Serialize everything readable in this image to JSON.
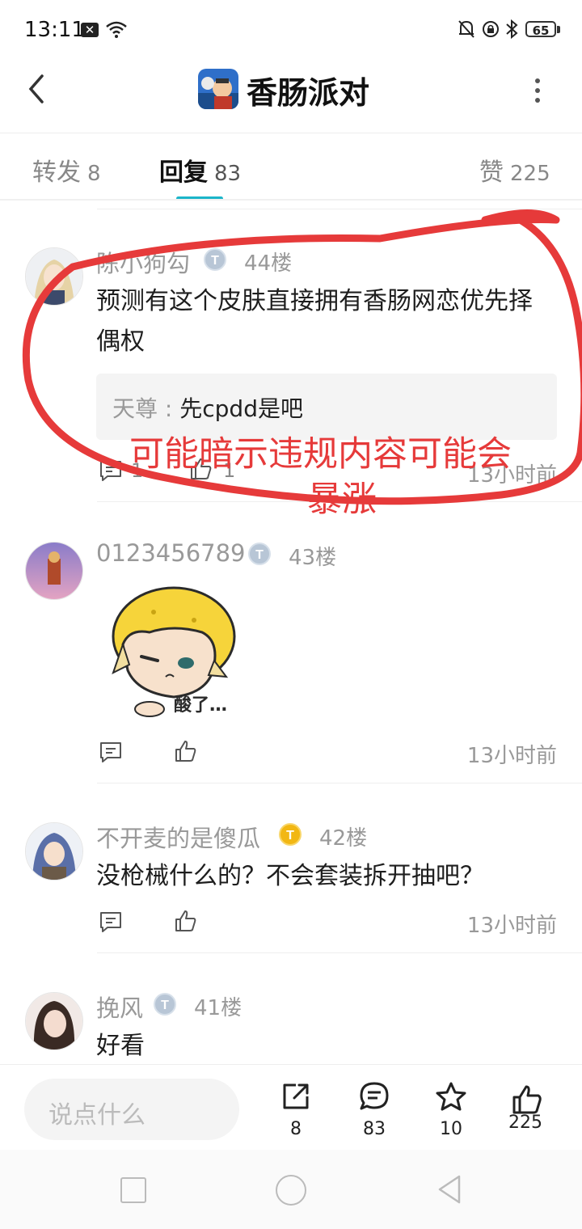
{
  "status_bar": {
    "time": "13:11",
    "battery": "65"
  },
  "header": {
    "title": "香肠派对"
  },
  "tabs": [
    {
      "label": "转发",
      "count": "8"
    },
    {
      "label": "回复",
      "count": "83"
    },
    {
      "label": "赞",
      "count": "225"
    }
  ],
  "comments": [
    {
      "user": "陈小狗勾",
      "floor": "44楼",
      "text_line1": "预测有这个皮肤直接拥有香肠网恋优先择",
      "text_line2": "偶权",
      "reply_author": "天尊",
      "reply_sep": " : ",
      "reply_text": "先cpdd是吧",
      "reply_count": "1",
      "like_count": "1",
      "time": "13小时前"
    },
    {
      "user": "0123456789",
      "floor": "43楼",
      "sticker_text": "酸了…",
      "time": "13小时前"
    },
    {
      "user": "不开麦的是傻瓜",
      "floor": "42楼",
      "text": "没枪械什么的？不会套装拆开抽吧？",
      "time": "13小时前"
    },
    {
      "user": "挽风",
      "floor": "41楼",
      "text": "好看"
    }
  ],
  "annotation": {
    "line1": "可能暗示违规内容可能会",
    "line2": "暴涨",
    "color": "#e63a3a"
  },
  "bottom": {
    "placeholder": "说点什么",
    "share": "8",
    "comment": "83",
    "favorite": "10",
    "like": "225"
  },
  "icons": [
    "back-icon",
    "more-icon",
    "comment-icon",
    "like-icon",
    "share-icon",
    "star-icon",
    "nav-square-icon",
    "nav-home-icon",
    "nav-back-icon"
  ],
  "colors": {
    "accent": "#1bb5c9",
    "annotation": "#e63a3a",
    "vip_badge": "#f2b713"
  }
}
